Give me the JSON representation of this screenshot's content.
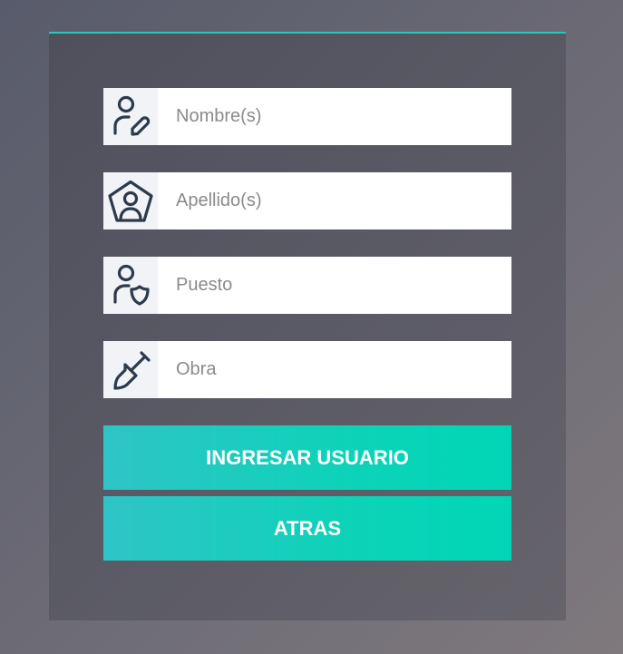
{
  "form": {
    "fields": [
      {
        "icon": "user-edit-icon",
        "placeholder": "Nombre(s)",
        "value": ""
      },
      {
        "icon": "user-pentagon-icon",
        "placeholder": "Apellido(s)",
        "value": ""
      },
      {
        "icon": "user-shield-icon",
        "placeholder": "Puesto",
        "value": ""
      },
      {
        "icon": "shovel-icon",
        "placeholder": "Obra",
        "value": ""
      }
    ],
    "submit_label": "INGRESAR USUARIO",
    "back_label": "ATRAS"
  },
  "colors": {
    "accent": "#2ac7bd",
    "button_start": "#2fc4c6",
    "button_end": "#00d6b7",
    "icon_stroke": "#2b3a4d",
    "icon_bg": "#f2f3f6"
  }
}
